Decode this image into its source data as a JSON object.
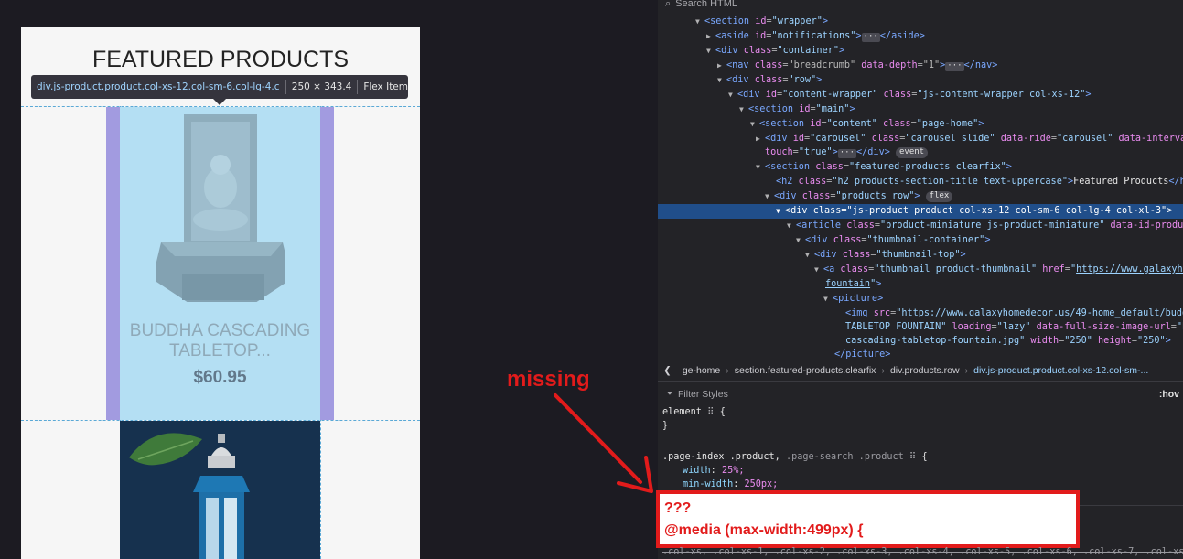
{
  "preview": {
    "title": "FEATURED PRODUCTS",
    "tooltip": {
      "selector": "div.js-product.product.col-xs-12.col-sm-6.col-lg-4.col-x...",
      "dimensions": "250 × 343.4",
      "type": "Flex Item"
    },
    "product": {
      "name_line1": "BUDDHA CASCADING",
      "name_line2": "TABLETOP...",
      "price": "$60.95"
    }
  },
  "annotation": {
    "label": "missing",
    "box_line1": "???",
    "box_line2": "@media (max-width:499px) {"
  },
  "devtools": {
    "search_placeholder": "Search HTML",
    "tree": [
      {
        "t": "<section id=\"wrapper\">"
      },
      {
        "t": "<aside id=\"notifications\"> ··· </aside>"
      },
      {
        "t": "<div class=\"container\">"
      },
      {
        "t": "<nav class=\"breadcrumb\" data-depth=\"1\"> ··· </nav>"
      },
      {
        "t": "<div class=\"row\">"
      },
      {
        "t": "<div id=\"content-wrapper\" class=\"js-content-wrapper col-xs-12\">"
      },
      {
        "t": "<section id=\"main\">"
      },
      {
        "t": "<section id=\"content\" class=\"page-home\">"
      },
      {
        "t": "<div id=\"carousel\" class=\"carousel slide\" data-ride=\"carousel\" data-interval"
      },
      {
        "t": "touch=\"true\"> ··· </div> event"
      },
      {
        "t": "<section class=\"featured-products clearfix\">"
      },
      {
        "t": "<h2 class=\"h2 products-section-title text-uppercase\">Featured Products</h2>"
      },
      {
        "t": "<div class=\"products row\"> flex"
      },
      {
        "t": "<div class=\"js-product product col-xs-12 col-sm-6 col-lg-4 col-xl-3\">"
      },
      {
        "t": "<article class=\"product-miniature js-product-miniature\" data-id-product"
      },
      {
        "t": "<div class=\"thumbnail-container\">"
      },
      {
        "t": "<div class=\"thumbnail-top\">"
      },
      {
        "t": "<a class=\"thumbnail product-thumbnail\" href=\"https://www.galaxyho"
      },
      {
        "t": "fountain\">"
      },
      {
        "t": "<picture>"
      },
      {
        "t": "<img src=\"https://www.galaxyhomedecor.us/49-home_default/budd"
      },
      {
        "t": "TABLETOP FOUNTAIN\" loading=\"lazy\" data-full-size-image-url=\"h"
      },
      {
        "t": "cascading-tabletop-fountain.jpg\" width=\"250\" height=\"250\">"
      },
      {
        "t": "</picture>"
      }
    ],
    "breadcrumbs": [
      "ge-home",
      "section.featured-products.clearfix",
      "div.products.row",
      "div.js-product.product.col-xs-12.col-sm-..."
    ],
    "filter_placeholder": "Filter Styles",
    "hov_label": ":hov",
    "rules": {
      "element_selector": "element",
      "element_open": "{",
      "element_close": "}",
      "rule2_selector_active": ".page-index .product,",
      "rule2_selector_struck": ".page-search .product",
      "rule2_open": "{",
      "decl1_prop": "width",
      "decl1_val": "25%;",
      "decl2_prop": "min-width",
      "decl2_val": "250px;",
      "rule2_close": "}"
    },
    "bottom_row": ".col-xs, .col-xs-1, .col-xs-2, .col-xs-3, .col-xs-4, .col-xs-5, .col-xs-6, .col-xs-7, .col-xs-"
  }
}
